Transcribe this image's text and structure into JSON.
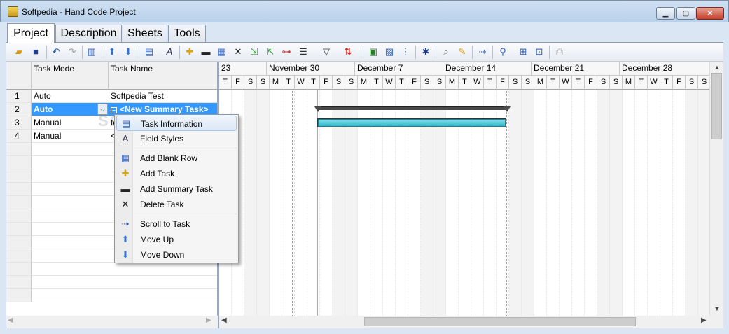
{
  "window": {
    "title": "Softpedia - Hand Code Project",
    "controls": {
      "minimize": "▁",
      "maximize": "▢",
      "close": "✕"
    }
  },
  "tabs": [
    {
      "label": "Project",
      "active": true
    },
    {
      "label": "Description"
    },
    {
      "label": "Sheets"
    },
    {
      "label": "Tools"
    }
  ],
  "toolbar": {
    "icons": [
      "open-folder-icon",
      "save-icon",
      "undo-icon",
      "redo-icon",
      "columns-icon",
      "move-up-icon",
      "move-down-icon",
      "task-information-icon",
      "field-styles-icon",
      "add-task-icon",
      "add-summary-task-icon",
      "add-blank-row-icon",
      "delete-task-icon",
      "indent-icon",
      "outdent-icon",
      "link-tasks-icon",
      "view-dropdown-icon",
      "filter-dropdown-icon",
      "sort-dropdown-icon",
      "calendar-icon",
      "resources-icon",
      "critical-path-icon",
      "settings-icon",
      "find-icon",
      "highlight-icon",
      "scroll-to-task-icon",
      "zoom-icon",
      "zoom-fit-icon",
      "zoom-task-icon",
      "print-icon"
    ]
  },
  "grid": {
    "columns": [
      "Task Mode",
      "Task Name"
    ],
    "rows": [
      {
        "num": "1",
        "mode": "Auto",
        "name": "Softpedia Test"
      },
      {
        "num": "2",
        "mode": "Auto",
        "name": "<New Summary Task>",
        "selected": true
      },
      {
        "num": "3",
        "mode": "Manual",
        "name": "te"
      },
      {
        "num": "4",
        "mode": "Manual",
        "name": "<"
      }
    ]
  },
  "timeline": {
    "weeks": [
      "23",
      "November 30",
      "December 7",
      "December 14",
      "December 21",
      "December 28"
    ],
    "days": [
      "T",
      "F",
      "S",
      "S",
      "M",
      "T",
      "W",
      "T",
      "F",
      "S",
      "S",
      "M",
      "T",
      "W",
      "T",
      "F",
      "S",
      "S",
      "M",
      "T",
      "W",
      "T",
      "F",
      "S",
      "S",
      "M",
      "T",
      "W",
      "T",
      "F",
      "S",
      "S",
      "M",
      "T",
      "W",
      "T",
      "F",
      "S",
      "S",
      "M",
      "T",
      "W",
      "T",
      "F",
      "S"
    ]
  },
  "watermark": "SOFTPEDIA",
  "context_menu": [
    {
      "label": "Task Information",
      "icon": "task-information-icon",
      "highlighted": true
    },
    {
      "label": "Field Styles",
      "icon": "field-styles-icon"
    },
    {
      "separator": true
    },
    {
      "label": "Add Blank Row",
      "icon": "add-blank-row-icon"
    },
    {
      "label": "Add Task",
      "icon": "add-task-icon"
    },
    {
      "label": "Add Summary Task",
      "icon": "add-summary-task-icon"
    },
    {
      "label": "Delete Task",
      "icon": "delete-task-icon"
    },
    {
      "separator": true
    },
    {
      "label": "Scroll to Task",
      "icon": "scroll-to-task-icon"
    },
    {
      "label": "Move Up",
      "icon": "move-up-icon"
    },
    {
      "label": "Move Down",
      "icon": "move-down-icon"
    }
  ],
  "colors": {
    "accent": "#3399ff",
    "summary_bar": "#4a4a4a",
    "task_bar": "#3cc4d8",
    "today_line": "#f0a030"
  }
}
